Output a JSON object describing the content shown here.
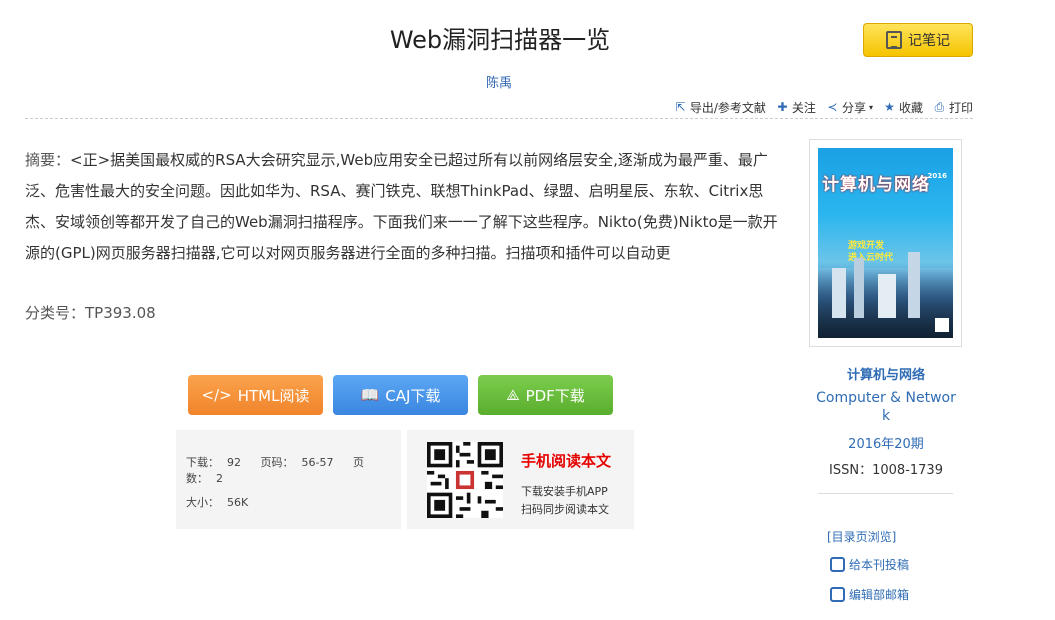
{
  "article": {
    "title": "Web漏洞扫描器一览",
    "author": "陈禹",
    "abstract_label": "摘要：",
    "abstract_text": "<正>据美国最权威的RSA大会研究显示,Web应用安全已超过所有以前网络层安全,逐渐成为最严重、最广泛、危害性最大的安全问题。因此如华为、RSA、赛门铁克、联想ThinkPad、绿盟、启明星辰、东软、Citrix思杰、安域领创等都开发了自己的Web漏洞扫描程序。下面我们来一一了解下这些程序。Nikto(免费)Nikto是一款开源的(GPL)网页服务器扫描器,它可以对网页服务器进行全面的多种扫描。扫描项和插件可以自动更",
    "class_label": "分类号：",
    "class_no": "TP393.08"
  },
  "note_button": "记笔记",
  "toolbar": {
    "export": "导出/参考文献",
    "follow": "关注",
    "share": "分享",
    "collect": "收藏",
    "print": "打印"
  },
  "downloads": {
    "html": "HTML阅读",
    "caj": "CAJ下载",
    "pdf": "PDF下载"
  },
  "stats": {
    "downloads_label": "下载：",
    "downloads": "92",
    "pages_label": "页码：",
    "pages": "56-57",
    "page_count_label": "页数：",
    "page_count": "2",
    "size_label": "大小：",
    "size": "56K"
  },
  "mobile": {
    "title": "手机阅读本文",
    "line1": "下载安装手机APP",
    "line2": "扫码同步阅读本文"
  },
  "journal": {
    "cover_title": "计算机与网络",
    "cover_year": "2016",
    "cover_sub1": "游戏开发",
    "cover_sub2": "进入云时代",
    "name": "计算机与网络",
    "name_en": "Computer & Network",
    "issue": "2016年20期",
    "issn_label": "ISSN：",
    "issn": "1008-1739"
  },
  "sidebar_links": {
    "toc": "[目录页浏览]",
    "submit": "给本刊投稿",
    "email": "编辑部邮箱"
  },
  "colors": {
    "link": "#2f6cb5",
    "html_btn": "#f0842b",
    "caj_btn": "#3a86e0",
    "pdf_btn": "#5aae2d",
    "mobile_title": "#e60000"
  }
}
